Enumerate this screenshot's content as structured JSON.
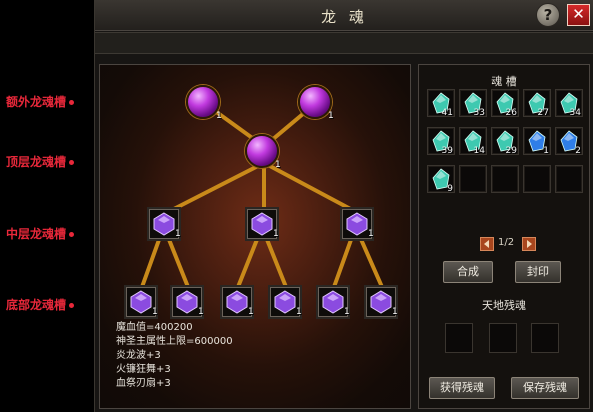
{
  "callouts": {
    "extra": "额外龙魂槽",
    "top": "顶层龙魂槽",
    "middle": "中层龙魂槽",
    "bottom": "底部龙魂槽"
  },
  "window": {
    "title": "龙 魂",
    "help_label": "?",
    "close_label": "✕"
  },
  "tree": {
    "extra_slots": [
      {
        "qty": "1"
      },
      {
        "qty": "1"
      }
    ],
    "top_slot": {
      "qty": "1"
    },
    "middle_slots": [
      {
        "qty": "1"
      },
      {
        "qty": "1"
      },
      {
        "qty": "1"
      }
    ],
    "bottom_slots": [
      {
        "qty": "1"
      },
      {
        "qty": "1"
      },
      {
        "qty": "1"
      },
      {
        "qty": "1"
      },
      {
        "qty": "1"
      },
      {
        "qty": "1"
      }
    ],
    "stats": [
      "魔血值=400200",
      "神圣主属性上限=600000",
      "炎龙波+3",
      "火镰狂舞+3",
      "血祭刃扇+3"
    ]
  },
  "slots_panel": {
    "label": "魂 槽",
    "row1": [
      "41",
      "33",
      "26",
      "27",
      "34"
    ],
    "row2": [
      "39",
      "14",
      "29",
      "1",
      "2"
    ],
    "row3": [
      "9"
    ],
    "page": "1/2",
    "combine_label": "合成",
    "seal_label": "封印",
    "soul_label": "天地残魂",
    "obtain_label": "获得残魂",
    "save_label": "保存残魂"
  },
  "colors": {
    "callout": "#e8283a",
    "gem_cyan": "#3ec9b0",
    "gem_blue": "#2f7ee8",
    "gem_purple": "#8b4be0",
    "connector": "#c98a1a"
  }
}
